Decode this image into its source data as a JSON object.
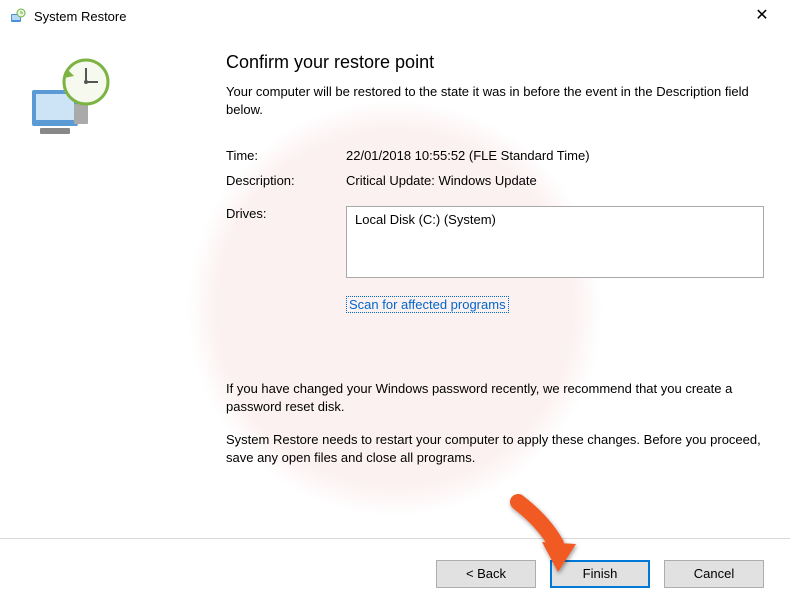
{
  "titlebar": {
    "title": "System Restore"
  },
  "main": {
    "heading": "Confirm your restore point",
    "subtext": "Your computer will be restored to the state it was in before the event in the Description field below.",
    "time_label": "Time:",
    "time_value": "22/01/2018 10:55:52 (FLE Standard Time)",
    "desc_label": "Description:",
    "desc_value": "Critical Update: Windows Update",
    "drives_label": "Drives:",
    "drives_value": "Local Disk (C:) (System)",
    "scan_link": "Scan for affected programs",
    "note1": "If you have changed your Windows password recently, we recommend that you create a password reset disk.",
    "note2": "System Restore needs to restart your computer to apply these changes. Before you proceed, save any open files and close all programs."
  },
  "footer": {
    "back": "< Back",
    "finish": "Finish",
    "cancel": "Cancel"
  }
}
